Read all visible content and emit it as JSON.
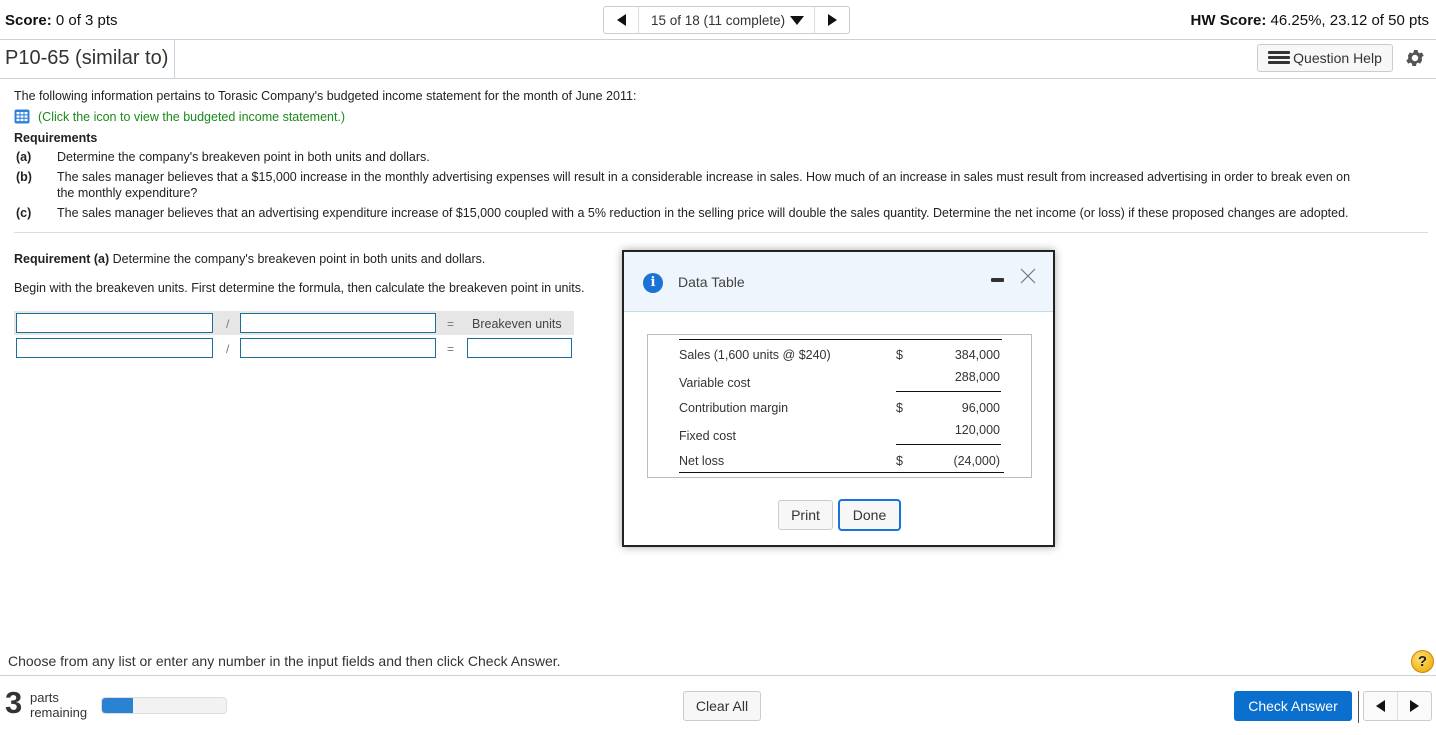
{
  "header": {
    "score_label": "Score:",
    "score_value": " 0 of 3 pts",
    "question_nav": {
      "position": "15 of 18 (11 complete)",
      "prev_icon": "triangle-left",
      "next_icon": "triangle-right",
      "dropdown_icon": "triangle-down"
    },
    "hw_score_label": "HW Score:",
    "hw_score_value": " 46.25%, 23.12 of 50 pts"
  },
  "titlebar": {
    "problem_title": "P10-65 (similar to)",
    "question_help_label": "Question Help",
    "question_help_icon": "list-icon",
    "settings_icon": "gear-icon"
  },
  "problem": {
    "intro": "The following information pertains to Torasic Company's budgeted income statement for the month of June 2011:",
    "table_link": "(Click the icon to view the budgeted income statement.)",
    "requirements_heading": "Requirements",
    "requirements": [
      {
        "label": "(a)",
        "text": "Determine the company's breakeven point in both units and dollars."
      },
      {
        "label": "(b)",
        "text": "The sales manager believes that a $15,000 increase in the monthly advertising expenses will result in a considerable increase in sales. How much of an increase in sales must result from increased advertising in order to break even on",
        "text2": "the monthly expenditure?"
      },
      {
        "label": "(c)",
        "text": "The sales manager believes that an advertising expenditure increase of $15,000 coupled with a 5% reduction in the selling price will double the sales quantity. Determine the net income (or loss) if these proposed changes are adopted."
      }
    ]
  },
  "requirement_a": {
    "heading_bold": "Requirement (a)",
    "heading_rest": " Determine the company's breakeven point in both units and dollars.",
    "instruction": "Begin with the breakeven units. First determine the formula, then calculate the breakeven point in units.",
    "formula": {
      "row1": {
        "input1": "",
        "op": "/",
        "input2": "",
        "eq": "=",
        "result_label": "Breakeven units"
      },
      "row2": {
        "input1": "",
        "op": "/",
        "input2": "",
        "eq": "=",
        "result_input": ""
      }
    }
  },
  "modal": {
    "title": "Data Table",
    "info_icon": "i",
    "rows": [
      {
        "label": "Sales (1,600 units @ $240)",
        "currency": "$",
        "amount": "384,000"
      },
      {
        "label": "Variable cost",
        "currency": "",
        "amount": "288,000"
      },
      {
        "label": "Contribution margin",
        "currency": "$",
        "amount": "96,000"
      },
      {
        "label": "Fixed cost",
        "currency": "",
        "amount": "120,000"
      },
      {
        "label": "Net loss",
        "currency": "$",
        "amount": "(24,000)"
      }
    ],
    "print_label": "Print",
    "done_label": "Done"
  },
  "footer": {
    "instruction": "Choose from any list or enter any number in the input fields and then click Check Answer.",
    "help_icon": "?",
    "parts_count": "3",
    "parts_word": "parts",
    "remaining_word": "remaining",
    "progress_fraction": 0.25,
    "clear_all_label": "Clear All",
    "check_answer_label": "Check Answer"
  },
  "colors": {
    "accent_blue": "#0a6fcd",
    "link_green": "#1a8a1a",
    "progress_blue": "#2b82d2",
    "input_border": "#1a6f9a"
  }
}
